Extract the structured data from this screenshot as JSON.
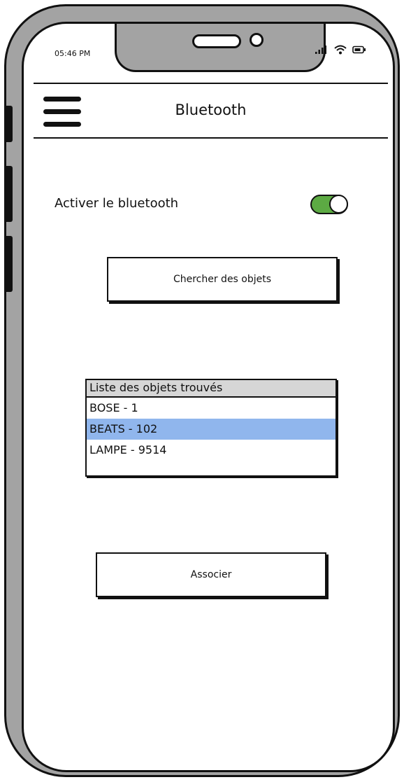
{
  "status_bar": {
    "time": "05:46 PM",
    "icons": [
      "signal-icon",
      "wifi-icon",
      "battery-icon"
    ]
  },
  "header": {
    "title": "Bluetooth",
    "menu_icon": "hamburger-menu-icon"
  },
  "bluetooth_toggle": {
    "label": "Activer le bluetooth",
    "enabled": true,
    "on_color": "#5caa43"
  },
  "search_button": {
    "label": "Chercher des objets"
  },
  "found_list": {
    "title": "Liste des objets trouvés",
    "items": [
      "BOSE - 1",
      "BEATS - 102",
      "LAMPE - 9514"
    ],
    "selected_index": 1,
    "selected_color": "#90b6ed"
  },
  "associate_button": {
    "label": "Associer"
  }
}
